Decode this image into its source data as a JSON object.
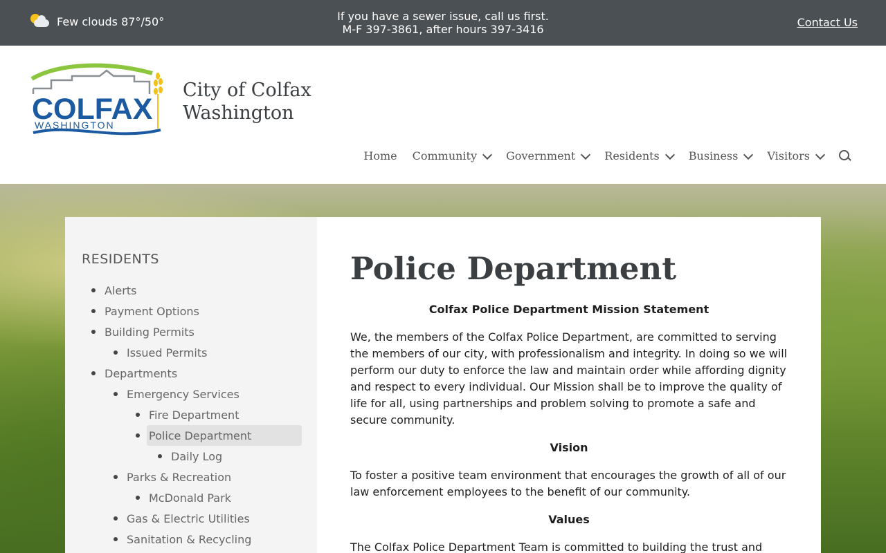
{
  "topbar": {
    "weather": "Few clouds 87°/50°",
    "notice_line1": "If you have a sewer issue, call us first.",
    "notice_line2": "M-F 397-3861, after hours 397-3416",
    "contact": "Contact Us"
  },
  "header": {
    "logo_text": "COLFAX",
    "logo_subtext": "WASHINGTON",
    "site_name_line1": "City of Colfax",
    "site_name_line2": "Washington",
    "colors": {
      "logo_blue": "#1b5aa1",
      "logo_green": "#8cc63f",
      "logo_gold": "#f2c21b"
    }
  },
  "nav": {
    "items": [
      {
        "label": "Home",
        "dropdown": false
      },
      {
        "label": "Community",
        "dropdown": true
      },
      {
        "label": "Government",
        "dropdown": true
      },
      {
        "label": "Residents",
        "dropdown": true
      },
      {
        "label": "Business",
        "dropdown": true
      },
      {
        "label": "Visitors",
        "dropdown": true
      }
    ],
    "search_icon": "search-icon"
  },
  "sidebar": {
    "title": "RESIDENTS",
    "items": [
      {
        "label": "Alerts",
        "level": 0
      },
      {
        "label": "Payment Options",
        "level": 0
      },
      {
        "label": "Building Permits",
        "level": 0
      },
      {
        "label": "Issued Permits",
        "level": 1
      },
      {
        "label": "Departments",
        "level": 0
      },
      {
        "label": "Emergency Services",
        "level": 1
      },
      {
        "label": "Fire Department",
        "level": 2
      },
      {
        "label": "Police Department",
        "level": 2,
        "active": true
      },
      {
        "label": "Daily Log",
        "level": 3
      },
      {
        "label": "Parks & Recreation",
        "level": 1
      },
      {
        "label": "McDonald Park",
        "level": 2
      },
      {
        "label": "Gas & Electric Utilities",
        "level": 1
      },
      {
        "label": "Sanitation & Recycling",
        "level": 1
      }
    ]
  },
  "main": {
    "title": "Police Department",
    "mission_heading": "Colfax Police Department Mission Statement",
    "mission_text": "We, the members of the Colfax Police Department, are committed to serving the members of our city, with professionalism and integrity. In doing so we will perform our duty to enforce the law and maintain order while affording dignity and respect to every individual. Our Mission shall be to improve the quality of life for all, using partnerships and problem solving to promote a safe and secure community.",
    "vision_heading": "Vision",
    "vision_text": "To foster a positive team environment that encourages the growth of all of our law enforcement employees to the benefit of our community.",
    "values_heading": "Values",
    "values_text": "The Colfax Police Department Team is committed to building the trust and"
  }
}
